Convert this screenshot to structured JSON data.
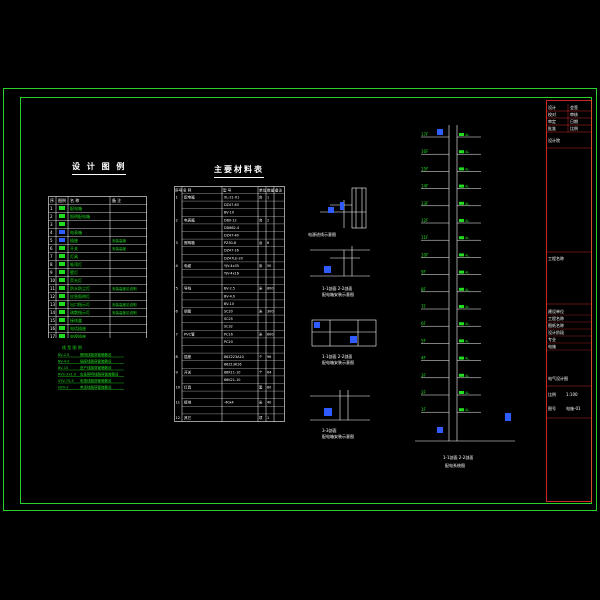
{
  "legend": {
    "title": "设 计 图 例",
    "header": [
      "序",
      "图例",
      "名 称",
      "备 注"
    ],
    "rows": [
      {
        "n": "1",
        "name": "配电箱",
        "note": ""
      },
      {
        "n": "2",
        "name": "照明配电箱",
        "note": ""
      },
      {
        "n": "3",
        "name": "",
        "note": ""
      },
      {
        "n": "4",
        "name": "电表箱",
        "note": ""
      },
      {
        "n": "5",
        "name": "插座",
        "note": "安装高度"
      },
      {
        "n": "6",
        "name": "开关",
        "note": "安装高度"
      },
      {
        "n": "7",
        "name": "灯具",
        "note": ""
      },
      {
        "n": "8",
        "name": "吸顶灯",
        "note": ""
      },
      {
        "n": "9",
        "name": "壁灯",
        "note": ""
      },
      {
        "n": "10",
        "name": "荧光灯",
        "note": ""
      },
      {
        "n": "11",
        "name": "防水防尘灯",
        "note": "安装高度见说明"
      },
      {
        "n": "12",
        "name": "应急照明灯",
        "note": ""
      },
      {
        "n": "13",
        "name": "出口指示灯",
        "note": "安装高度见说明"
      },
      {
        "n": "14",
        "name": "疏散指示灯",
        "note": "安装高度见说明"
      },
      {
        "n": "15",
        "name": "接线盒",
        "note": ""
      },
      {
        "n": "16",
        "name": "电话插座",
        "note": ""
      },
      {
        "n": "17",
        "name": "电视插座",
        "note": ""
      }
    ],
    "line_legend_title": "线 型 图 例",
    "line_legend": [
      {
        "code": "BV-2.5",
        "desc": "照明线路穿管暗敷设"
      },
      {
        "code": "BV-4.0",
        "desc": "插座线路穿管暗敷设"
      },
      {
        "code": "BV-10",
        "desc": "进户线路穿管暗敷设"
      },
      {
        "code": "RVS-2x1.0",
        "desc": "应急照明线路穿管暗敷设"
      },
      {
        "code": "SYV-75-5",
        "desc": "电视线路穿管暗敷设"
      },
      {
        "code": "HYV-2",
        "desc": "电话线路穿管暗敷设"
      }
    ]
  },
  "materials": {
    "title": "主要材料表",
    "header": [
      "序号",
      "名 称",
      "型 号",
      "单位",
      "数量",
      "备注"
    ],
    "rows": [
      {
        "n": "1",
        "name": "配电箱",
        "model": "XL-21-01",
        "u": "台",
        "q": "1"
      },
      {
        "n": "",
        "name": "",
        "model": "DZ47-63",
        "u": "",
        "q": ""
      },
      {
        "n": "",
        "name": "",
        "model": "BV-10",
        "u": "",
        "q": ""
      },
      {
        "n": "2",
        "name": "电表箱",
        "model": "DBX-12",
        "u": "台",
        "q": "2"
      },
      {
        "n": "",
        "name": "",
        "model": "DD862-4",
        "u": "",
        "q": ""
      },
      {
        "n": "",
        "name": "",
        "model": "DZ47-40",
        "u": "",
        "q": ""
      },
      {
        "n": "3",
        "name": "照明箱",
        "model": "PZ30-8",
        "u": "台",
        "q": "6"
      },
      {
        "n": "",
        "name": "",
        "model": "DZ47-16",
        "u": "",
        "q": ""
      },
      {
        "n": "",
        "name": "",
        "model": "DZ47LE-20",
        "u": "",
        "q": ""
      },
      {
        "n": "4",
        "name": "电缆",
        "model": "YJV-4x35",
        "u": "米",
        "q": "50"
      },
      {
        "n": "",
        "name": "",
        "model": "YJV-4x16",
        "u": "",
        "q": ""
      },
      {
        "n": "",
        "name": "",
        "model": "",
        "u": "",
        "q": ""
      },
      {
        "n": "5",
        "name": "导线",
        "model": "BV-2.5",
        "u": "米",
        "q": "800"
      },
      {
        "n": "",
        "name": "",
        "model": "BV-4.0",
        "u": "",
        "q": ""
      },
      {
        "n": "",
        "name": "",
        "model": "BV-10",
        "u": "",
        "q": ""
      },
      {
        "n": "6",
        "name": "钢管",
        "model": "SC20",
        "u": "米",
        "q": "300"
      },
      {
        "n": "",
        "name": "",
        "model": "SC25",
        "u": "",
        "q": ""
      },
      {
        "n": "",
        "name": "",
        "model": "SC32",
        "u": "",
        "q": ""
      },
      {
        "n": "7",
        "name": "PVC管",
        "model": "PC16",
        "u": "米",
        "q": "600"
      },
      {
        "n": "",
        "name": "",
        "model": "PC20",
        "u": "",
        "q": ""
      },
      {
        "n": "",
        "name": "",
        "model": "",
        "u": "",
        "q": ""
      },
      {
        "n": "8",
        "name": "插座",
        "model": "86Z223A10",
        "u": "个",
        "q": "96"
      },
      {
        "n": "",
        "name": "",
        "model": "86Z13K16",
        "u": "",
        "q": ""
      },
      {
        "n": "9",
        "name": "开关",
        "model": "86K11-10",
        "u": "个",
        "q": "64"
      },
      {
        "n": "",
        "name": "",
        "model": "86K21-10",
        "u": "",
        "q": ""
      },
      {
        "n": "10",
        "name": "灯具",
        "model": "",
        "u": "套",
        "q": "80"
      },
      {
        "n": "",
        "name": "",
        "model": "",
        "u": "",
        "q": ""
      },
      {
        "n": "11",
        "name": "接地",
        "model": "-40x4",
        "u": "米",
        "q": "40"
      },
      {
        "n": "",
        "name": "",
        "model": "",
        "u": "",
        "q": ""
      },
      {
        "n": "12",
        "name": "其它",
        "model": "",
        "u": "项",
        "q": "1"
      }
    ]
  },
  "details": {
    "d1": "电源进线示意图",
    "d2_top": "1-1剖面  2-2剖面",
    "d2": "配电箱安装示意图",
    "d3_top": "1-1剖面  2-2剖面",
    "d3": "配电箱安装示意图",
    "d4_top": "3-3剖面",
    "d4": "配电箱安装示意图"
  },
  "riser": {
    "caption_top": "1-1剖面  2-2剖面",
    "caption": "配电系统图",
    "floor_labels": [
      "17F",
      "16F",
      "15F",
      "14F",
      "13F",
      "12F",
      "11F",
      "10F",
      "9F",
      "8F",
      "7F",
      "6F",
      "5F",
      "4F",
      "3F",
      "2F",
      "1F"
    ],
    "box_label": "AL"
  },
  "title_block": {
    "rows_top": [
      [
        "设计",
        "会签"
      ],
      [
        "校对",
        "审核"
      ],
      [
        "审定",
        "日期"
      ],
      [
        "批准",
        "比例"
      ]
    ],
    "company": "设计院",
    "project": "工程名称",
    "mid_rows": [
      "建设单位",
      "工程名称",
      "图纸名称",
      "设计阶段",
      "专业",
      "电施"
    ],
    "drawing_title": "电气设计图",
    "scale_label": "比例",
    "scale_value": "1:100",
    "sheet_label": "图号",
    "sheet_value": "电施-01"
  },
  "colors": {
    "frame": "#2bd12b",
    "line": "#ffffff",
    "symbol": "#22dd22",
    "accent": "#2f5bff",
    "titleblock": "#ff3030"
  }
}
